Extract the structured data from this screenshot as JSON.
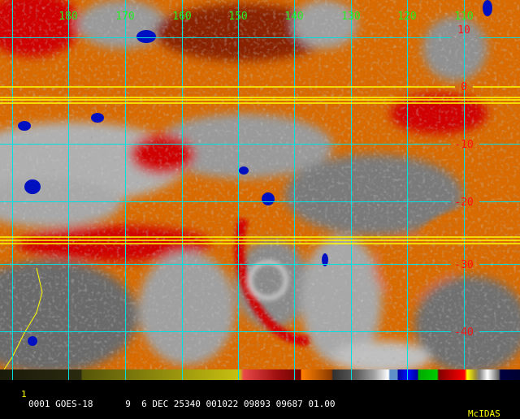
{
  "header": {
    "longitude_labels": [
      "180",
      "170",
      "160",
      "150",
      "140",
      "130",
      "120",
      "110"
    ]
  },
  "grid": {
    "latitude_labels": [
      "10",
      "0",
      "-10",
      "-20",
      "-30",
      "-40"
    ],
    "grid_color": "#00e0e0",
    "equator_color": "#ffff00"
  },
  "footer": {
    "frame_number": "1",
    "info_text": "0001 GOES-18      9  6 DEC 25340 001022 09893 09687 01.00",
    "software": "McIDAS"
  },
  "colors": {
    "moist": "#808080",
    "dry": "#ff8000",
    "very_dry": "#d00000",
    "cold_cloud": "#0010c0"
  }
}
